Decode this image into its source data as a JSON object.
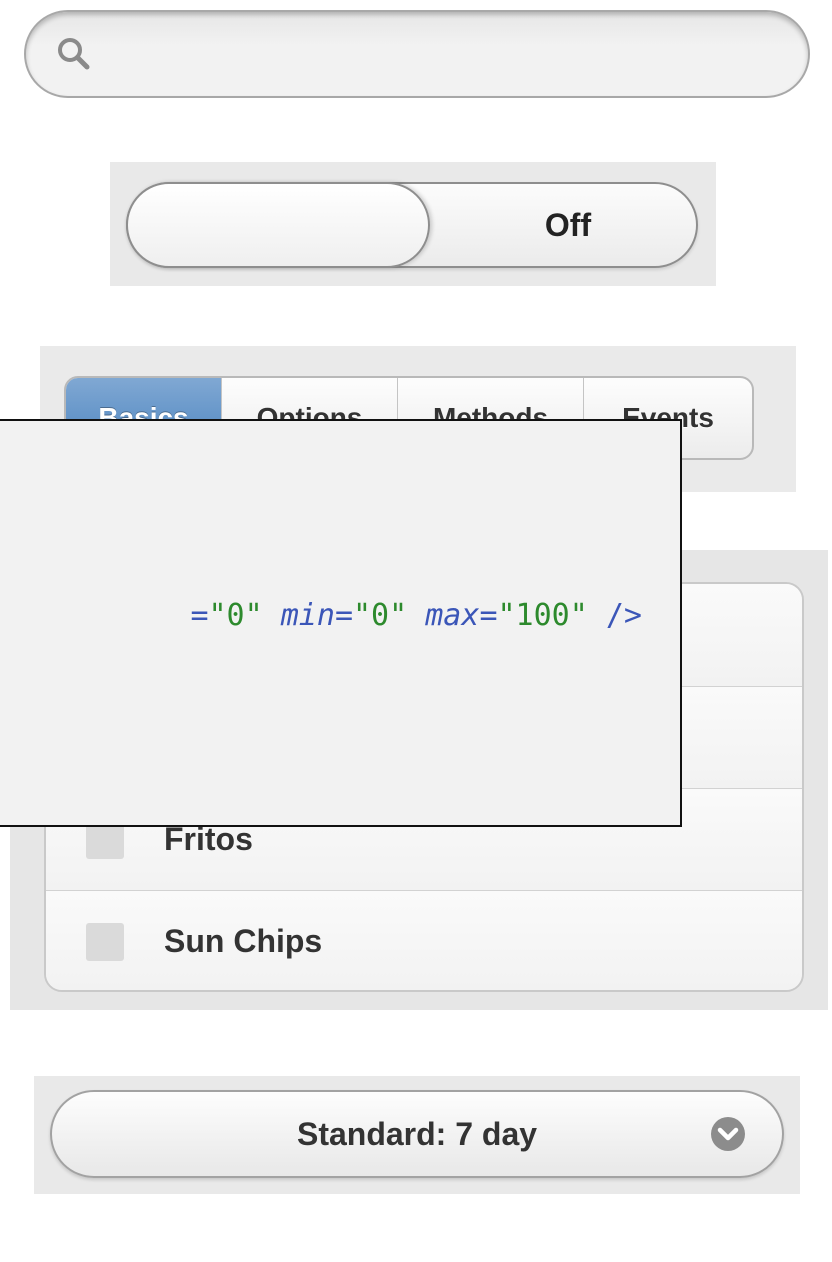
{
  "search": {
    "icon": "search-icon",
    "placeholder": ""
  },
  "toggle": {
    "state_label": "Off"
  },
  "tabs": [
    {
      "label": "Basics",
      "active": true
    },
    {
      "label": "Options",
      "active": false
    },
    {
      "label": "Methods",
      "active": false
    },
    {
      "label": "Events",
      "active": false
    }
  ],
  "list": {
    "items": [
      {
        "label": "",
        "checked": false
      },
      {
        "label": "",
        "checked": false
      },
      {
        "label": "Fritos",
        "checked": false
      },
      {
        "label": "Sun Chips",
        "checked": false
      }
    ]
  },
  "code": {
    "fragment_start": "=",
    "value_attr_value": "\"0\"",
    "min_attr": "min",
    "min_value": "\"0\"",
    "max_attr": "max",
    "max_value": "\"100\"",
    "close_tag": "/>"
  },
  "select": {
    "value": "Standard: 7 day",
    "icon": "chevron-down-icon"
  },
  "colors": {
    "active_tab": "#4a83bf",
    "code_attr": "#3b56b8",
    "code_value": "#2d8a2d"
  }
}
